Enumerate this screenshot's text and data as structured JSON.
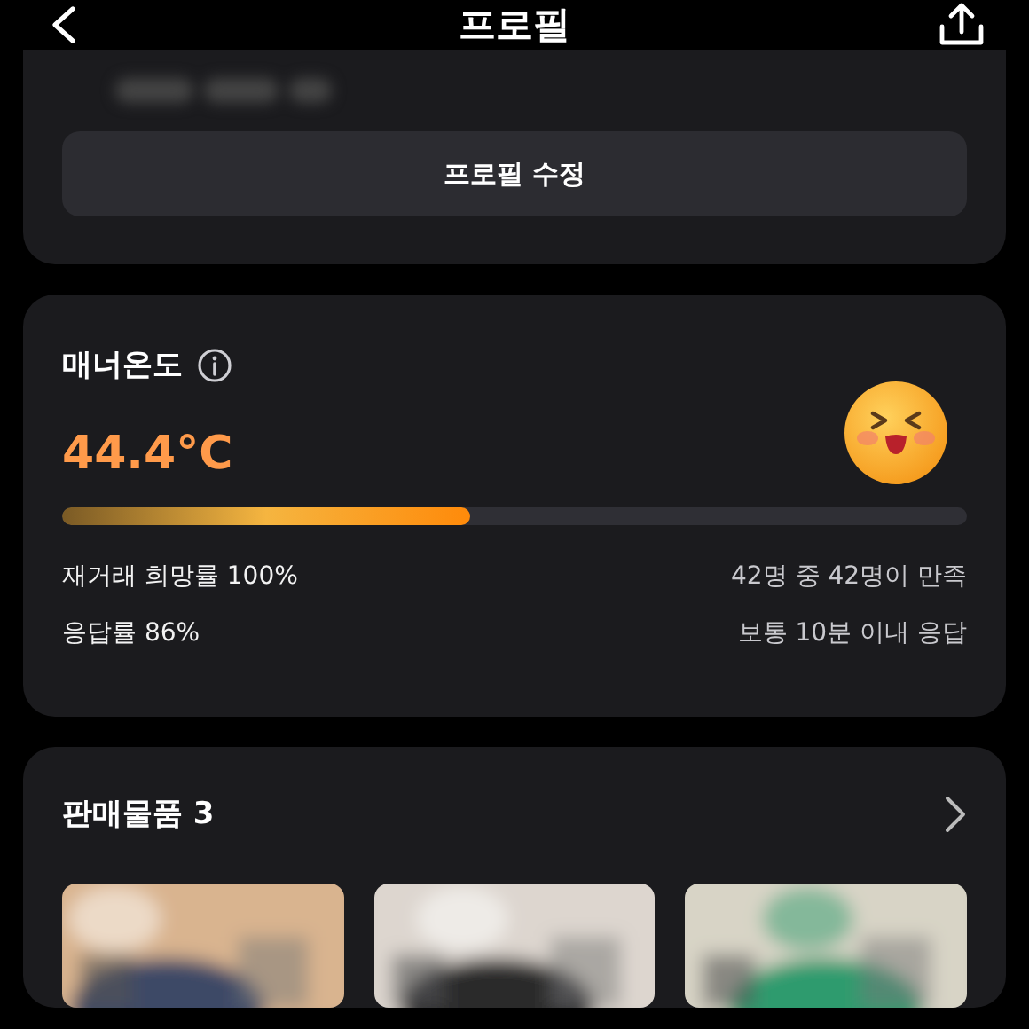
{
  "header": {
    "title": "프로필"
  },
  "profile_card": {
    "edit_button": "프로필 수정"
  },
  "manner": {
    "title": "매너온도",
    "temperature": "44.4°C",
    "level": 0.45,
    "stats": [
      {
        "left": "재거래 희망률 100%",
        "right": "42명 중 42명이 만족"
      },
      {
        "left": "응답률 86%",
        "right": "보통 10분 이내 응답"
      }
    ]
  },
  "sales": {
    "title": "판매물품 3"
  }
}
